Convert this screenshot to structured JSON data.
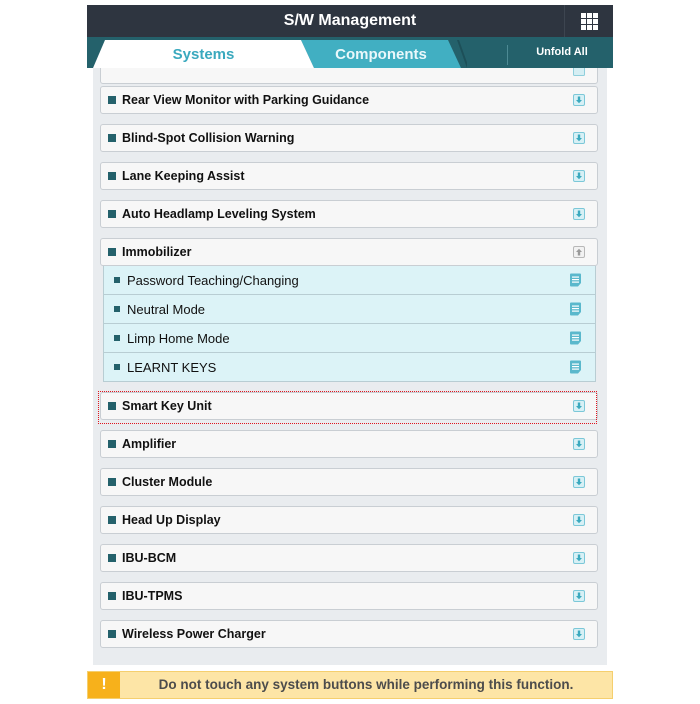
{
  "header": {
    "title": "S/W Management",
    "menu_icon": "grid-menu-icon"
  },
  "tabs": [
    {
      "label": "Systems",
      "active": true
    },
    {
      "label": "Components",
      "active": false
    }
  ],
  "unfold_all_label": "Unfold All",
  "systems": [
    {
      "label": "Rear View Monitor with Parking Guidance",
      "icon": "download-icon",
      "expanded": false
    },
    {
      "label": "Blind-Spot Collision Warning",
      "icon": "download-icon",
      "expanded": false
    },
    {
      "label": "Lane Keeping Assist",
      "icon": "download-icon",
      "expanded": false
    },
    {
      "label": "Auto Headlamp Leveling System",
      "icon": "download-icon",
      "expanded": false
    },
    {
      "label": "Immobilizer",
      "icon": "collapse-up-icon",
      "expanded": true
    },
    {
      "label": "Smart Key Unit",
      "icon": "download-icon",
      "expanded": false
    },
    {
      "label": "Amplifier",
      "icon": "download-icon",
      "expanded": false
    },
    {
      "label": "Cluster Module",
      "icon": "download-icon",
      "expanded": false
    },
    {
      "label": "Head Up Display",
      "icon": "download-icon",
      "expanded": false
    },
    {
      "label": "IBU-BCM",
      "icon": "download-icon",
      "expanded": false
    },
    {
      "label": "IBU-TPMS",
      "icon": "download-icon",
      "expanded": false
    },
    {
      "label": "Wireless Power Charger",
      "icon": "download-icon",
      "expanded": false
    }
  ],
  "immobilizer_functions": [
    {
      "label": "Password Teaching/Changing",
      "icon": "note-icon"
    },
    {
      "label": "Neutral Mode",
      "icon": "note-icon"
    },
    {
      "label": "Limp Home Mode",
      "icon": "note-icon"
    },
    {
      "label": "LEARNT KEYS",
      "icon": "note-icon",
      "selected": true
    }
  ],
  "warning": {
    "icon": "!",
    "message": "Do not touch any system buttons while performing this function."
  },
  "colors": {
    "header_bg": "#2e3540",
    "tabbar_bg": "#24616b",
    "active_tab_text": "#3aa9be",
    "inactive_tab_bg": "#41afc2",
    "sub_item_bg": "#dcf3f7",
    "selection_border": "#e0141e",
    "warning_bg": "#fde5a6",
    "warning_icon_bg": "#f7b11b"
  }
}
